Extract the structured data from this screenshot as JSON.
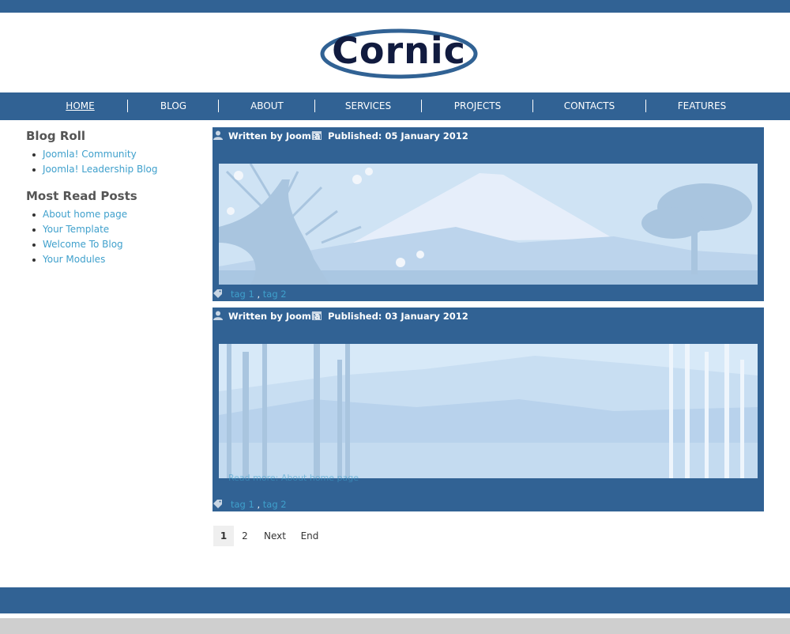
{
  "brand": {
    "logo_text": "Cornic"
  },
  "colors": {
    "primary": "#316294",
    "link": "#3fa0cc",
    "logo_dark": "#111b3f"
  },
  "nav": {
    "items": [
      {
        "label": "HOME",
        "active": true
      },
      {
        "label": "BLOG"
      },
      {
        "label": "ABOUT"
      },
      {
        "label": "SERVICES"
      },
      {
        "label": "PROJECTS"
      },
      {
        "label": "CONTACTS"
      },
      {
        "label": "FEATURES"
      }
    ]
  },
  "sidebar": {
    "blogroll": {
      "title": "Blog Roll",
      "links": [
        "Joomla! Community",
        "Joomla! Leadership Blog"
      ]
    },
    "most_read": {
      "title": "Most Read Posts",
      "links": [
        "About home page",
        "Your Template",
        "Welcome To Blog",
        "Your Modules"
      ]
    }
  },
  "posts": [
    {
      "author": "Written by Joomla",
      "published": "Published: 05 January 2012",
      "image": "mountain-blossom-illustration",
      "tags": [
        "tag 1",
        "tag 2"
      ],
      "tag_separator": " , "
    },
    {
      "author": "Written by Joomla",
      "published": "Published: 03 January 2012",
      "image": "bamboo-mountain-illustration",
      "read_more": "Read more: About home page",
      "tags": [
        "tag 1",
        "tag 2"
      ],
      "tag_separator": " , "
    }
  ],
  "pagination": {
    "pages": [
      "1",
      "2"
    ],
    "next": "Next",
    "end": "End",
    "current": "1"
  },
  "icons": {
    "author": "user-icon",
    "published": "calendar-icon",
    "tags": "tag-icon"
  }
}
